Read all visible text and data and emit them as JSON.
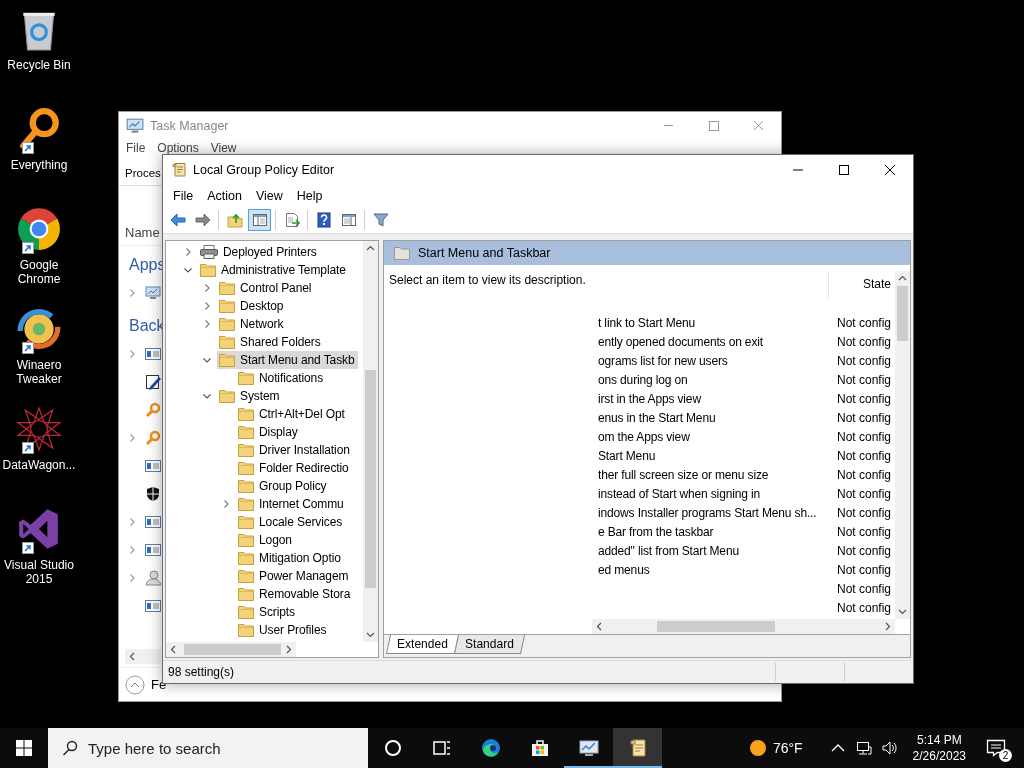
{
  "desktop_icons": [
    {
      "label": "Recycle Bin",
      "kind": "recycle",
      "shortcut": false
    },
    {
      "label": "Everything",
      "kind": "magnifier",
      "shortcut": true
    },
    {
      "label": "Google Chrome",
      "kind": "wheel",
      "shortcut": true
    },
    {
      "label": "Winaero Tweaker",
      "kind": "swirl",
      "shortcut": true
    },
    {
      "label": "DataWagon...",
      "kind": "star",
      "shortcut": true
    },
    {
      "label": "Visual Studio 2015",
      "kind": "bowtie",
      "shortcut": true
    }
  ],
  "task_manager": {
    "title": "Task Manager",
    "menu": [
      "File",
      "Options",
      "View"
    ],
    "tab": "Proces",
    "column": "Name",
    "sections": [
      {
        "title": "Apps",
        "rows": [
          {
            "kind": "monitor",
            "expandable": true
          }
        ]
      },
      {
        "title": "Back",
        "rows": [
          {
            "kind": "window",
            "expandable": true
          },
          {
            "kind": "note",
            "expandable": false
          },
          {
            "kind": "magnifier",
            "expandable": false
          },
          {
            "kind": "magnifier",
            "expandable": true
          },
          {
            "kind": "window",
            "expandable": false
          },
          {
            "kind": "shield",
            "expandable": false
          },
          {
            "kind": "window",
            "expandable": true
          },
          {
            "kind": "window",
            "expandable": true
          },
          {
            "kind": "person",
            "expandable": true
          },
          {
            "kind": "window",
            "expandable": false
          }
        ]
      }
    ],
    "footer": "Fe"
  },
  "policy_editor": {
    "title": "Local Group Policy Editor",
    "menu": [
      "File",
      "Action",
      "View",
      "Help"
    ],
    "toolbar": [
      {
        "kind": "back",
        "pressed": false
      },
      {
        "kind": "forward",
        "pressed": false
      },
      {
        "kind": "separator"
      },
      {
        "kind": "up",
        "pressed": false
      },
      {
        "kind": "tree",
        "pressed": true
      },
      {
        "kind": "separator"
      },
      {
        "kind": "export",
        "pressed": false
      },
      {
        "kind": "separator"
      },
      {
        "kind": "help",
        "pressed": false
      },
      {
        "kind": "panel",
        "pressed": false
      },
      {
        "kind": "separator"
      },
      {
        "kind": "filter",
        "pressed": false
      }
    ],
    "tree": [
      {
        "label": "Deployed Printers",
        "kind": "printer",
        "expandable": true,
        "expanded": false,
        "selected": false
      },
      {
        "label": "Administrative Template",
        "kind": "folder",
        "expandable": true,
        "expanded": true,
        "selected": false,
        "children": [
          {
            "label": "Control Panel",
            "kind": "folder",
            "expandable": true,
            "expanded": false,
            "selected": false
          },
          {
            "label": "Desktop",
            "kind": "folder",
            "expandable": true,
            "expanded": false,
            "selected": false
          },
          {
            "label": "Network",
            "kind": "folder",
            "expandable": true,
            "expanded": false,
            "selected": false
          },
          {
            "label": "Shared Folders",
            "kind": "folder",
            "expandable": false,
            "expanded": false,
            "selected": false
          },
          {
            "label": "Start Menu and Taskb",
            "kind": "folder",
            "expandable": true,
            "expanded": true,
            "selected": true,
            "children": [
              {
                "label": "Notifications",
                "kind": "folder",
                "expandable": false,
                "expanded": false,
                "selected": false
              }
            ]
          },
          {
            "label": "System",
            "kind": "folder",
            "expandable": true,
            "expanded": true,
            "selected": false,
            "children": [
              {
                "label": "Ctrl+Alt+Del Opt",
                "kind": "folder",
                "expandable": false,
                "expanded": false,
                "selected": false
              },
              {
                "label": "Display",
                "kind": "folder",
                "expandable": false,
                "expanded": false,
                "selected": false
              },
              {
                "label": "Driver Installation",
                "kind": "folder",
                "expandable": false,
                "expanded": false,
                "selected": false
              },
              {
                "label": "Folder Redirectio",
                "kind": "folder",
                "expandable": false,
                "expanded": false,
                "selected": false
              },
              {
                "label": "Group Policy",
                "kind": "folder",
                "expandable": false,
                "expanded": false,
                "selected": false
              },
              {
                "label": "Internet Commu",
                "kind": "folder",
                "expandable": true,
                "expanded": false,
                "selected": false
              },
              {
                "label": "Locale Services",
                "kind": "folder",
                "expandable": false,
                "expanded": false,
                "selected": false
              },
              {
                "label": "Logon",
                "kind": "folder",
                "expandable": false,
                "expanded": false,
                "selected": false
              },
              {
                "label": "Mitigation Optio",
                "kind": "folder",
                "expandable": false,
                "expanded": false,
                "selected": false
              },
              {
                "label": "Power Managem",
                "kind": "folder",
                "expandable": false,
                "expanded": false,
                "selected": false
              },
              {
                "label": "Removable Stora",
                "kind": "folder",
                "expandable": false,
                "expanded": false,
                "selected": false
              },
              {
                "label": "Scripts",
                "kind": "folder",
                "expandable": false,
                "expanded": false,
                "selected": false
              },
              {
                "label": "User Profiles",
                "kind": "folder",
                "expandable": false,
                "expanded": false,
                "selected": false
              }
            ]
          }
        ]
      }
    ],
    "header": "Start Menu and Taskbar",
    "description": "Select an item to view its description.",
    "columns": [
      "State"
    ],
    "rows": [
      {
        "setting": "t link to Start Menu",
        "state": "Not config"
      },
      {
        "setting": "ently opened documents on exit",
        "state": "Not config"
      },
      {
        "setting": "ograms list for new users",
        "state": "Not config"
      },
      {
        "setting": "ons during log on",
        "state": "Not config"
      },
      {
        "setting": "irst in the Apps view",
        "state": "Not config"
      },
      {
        "setting": "enus in the Start Menu",
        "state": "Not config"
      },
      {
        "setting": "om the Apps view",
        "state": "Not config"
      },
      {
        "setting": "Start Menu",
        "state": "Not config"
      },
      {
        "setting": "ther full screen size or menu size",
        "state": "Not config"
      },
      {
        "setting": "instead of Start when signing in",
        "state": "Not config"
      },
      {
        "setting": "indows Installer programs Start Menu sh...",
        "state": "Not config"
      },
      {
        "setting": "e Bar from the taskbar",
        "state": "Not config"
      },
      {
        "setting": "added\" list from Start Menu",
        "state": "Not config"
      },
      {
        "setting": "ed menus",
        "state": "Not config"
      },
      {
        "state": "Not config"
      },
      {
        "state": "Not config"
      }
    ],
    "tabs": [
      {
        "label": "Extended",
        "selected": true
      },
      {
        "label": "Standard",
        "selected": false
      }
    ],
    "status_bar": "98 setting(s)"
  },
  "taskbar": {
    "search": {
      "placeholder": "Type here to search"
    },
    "apps": [
      {
        "kind": "ring",
        "running": false,
        "selected": false
      },
      {
        "kind": "task_view",
        "running": false,
        "selected": false
      },
      {
        "kind": "edge",
        "running": false,
        "selected": false
      },
      {
        "kind": "store",
        "running": false,
        "selected": false
      },
      {
        "kind": "task_manager",
        "running": true,
        "selected": false
      },
      {
        "kind": "policy_editor",
        "running": true,
        "selected": true
      }
    ],
    "weather": "76°F",
    "time": "5:14 PM",
    "date": "2/26/2023",
    "notifications": "2"
  }
}
